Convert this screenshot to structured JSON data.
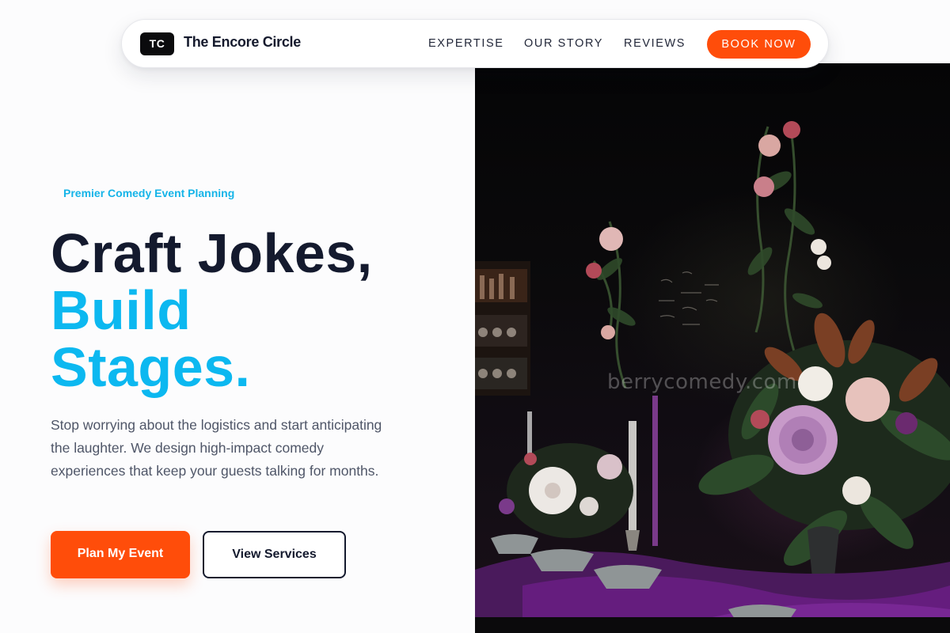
{
  "navbar": {
    "logo_badge": "TC",
    "brand_name": "The Encore Circle",
    "links": [
      "EXPERTISE",
      "OUR STORY",
      "REVIEWS"
    ],
    "cta_label": "BOOK NOW"
  },
  "hero": {
    "eyebrow": "Premier Comedy Event Planning",
    "headline": {
      "line1": "Craft Jokes,",
      "line2": "Build",
      "line3": "Stages."
    },
    "lead": "Stop worrying about the logistics and start anticipating the laughter. We design high-impact comedy experiences that keep your guests talking for months.",
    "primary_button": "Plan My Event",
    "secondary_button": "View Services"
  },
  "hero_image": {
    "subject": "dark banquet table with floral centerpieces and candles",
    "watermark": "berrycomedy.com"
  },
  "colors": {
    "accent_orange": "#ff4d0a",
    "accent_blue": "#0cb8f0",
    "text_dark": "#141a2e",
    "text_muted": "#4f5668",
    "background": "#fcfcfd"
  }
}
